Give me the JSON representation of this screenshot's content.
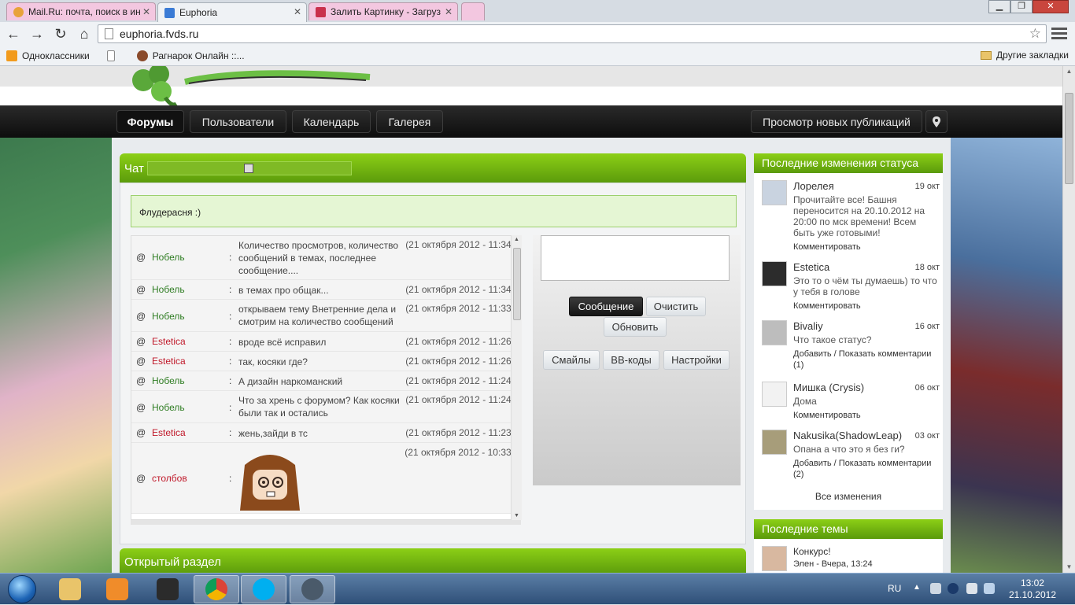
{
  "browser": {
    "tabs": [
      {
        "title": "Mail.Ru: почта, поиск в ин",
        "active": false,
        "color": "#e8a23a"
      },
      {
        "title": "Euphoria",
        "active": true,
        "color": "#3a7bd5"
      },
      {
        "title": "Залить Картинку - Загруз",
        "active": false,
        "color": "#c9304c"
      }
    ],
    "url": "euphoria.fvds.ru",
    "bookmarks": [
      {
        "label": "Одноклассники",
        "color": "#f29b1d"
      },
      {
        "label": "",
        "color": "#ffffff"
      },
      {
        "label": "Рагнарок Онлайн ::...",
        "color": "#8a4b2c"
      }
    ],
    "other_bookmarks": "Другие закладки"
  },
  "site": {
    "nav_left": [
      "Форумы",
      "Пользователи",
      "Календарь",
      "Галерея"
    ],
    "nav_right": "Просмотр новых публикаций"
  },
  "chat": {
    "title": "Чат",
    "topic": "Флудерасня :)",
    "messages": [
      {
        "nick": "Нобель",
        "nick_color": "green",
        "text": "Количество просмотров, количество сообщений в темах, последнее сообщение....",
        "time": "(21 октября 2012 - 11:34 )"
      },
      {
        "nick": "Нобель",
        "nick_color": "green",
        "text": "в темах про общак...",
        "time": "(21 октября 2012 - 11:34 )"
      },
      {
        "nick": "Нобель",
        "nick_color": "green",
        "text": "открываем тему Внетренние дела и смотрим на количество сообщений в темах",
        "time": "(21 октября 2012 - 11:33 )"
      },
      {
        "nick": "Estetica",
        "nick_color": "red",
        "text": "вроде всё исправил",
        "time": "(21 октября 2012 - 11:26 )"
      },
      {
        "nick": "Estetica",
        "nick_color": "red",
        "text": "так, косяки где?",
        "time": "(21 октября 2012 - 11:26 )"
      },
      {
        "nick": "Нобель",
        "nick_color": "green",
        "text": "А дизайн наркоманский",
        "time": "(21 октября 2012 - 11:24 )"
      },
      {
        "nick": "Нобель",
        "nick_color": "green",
        "text": "Что за хрень с форумом? Как косяки были так и остались",
        "time": "(21 октября 2012 - 11:24 )"
      },
      {
        "nick": "Estetica",
        "nick_color": "red",
        "text": "жень,зайди в тс",
        "time": "(21 октября 2012 - 11:23 )"
      },
      {
        "nick": "столбов",
        "nick_color": "red",
        "text": "",
        "time": "(21 октября 2012 - 10:33 )"
      }
    ],
    "buttons": {
      "send": "Сообщение",
      "clear": "Очистить",
      "refresh": "Обновить",
      "smileys": "Смайлы",
      "bbcodes": "BB-коды",
      "settings": "Настройки"
    }
  },
  "open_section": {
    "title": "Открытый раздел"
  },
  "status_updates": {
    "title": "Последние изменения статуса",
    "items": [
      {
        "name": "Лорелея",
        "date": "19 окт",
        "text": "Прочитайте все! Башня переносится на 20.10.2012 на 20:00 по мск времени! Всем быть уже готовыми!",
        "action": "Комментировать"
      },
      {
        "name": "Estetica",
        "date": "18 окт",
        "text": "Это то о чём ты думаешь) то что у тебя в голове",
        "action": "Комментировать"
      },
      {
        "name": "Bivaliy",
        "date": "16 окт",
        "text": "Что такое статус?",
        "action": "Добавить / Показать комментарии (1)"
      },
      {
        "name": "Мишка (Crysis)",
        "date": "06 окт",
        "text": "Дома",
        "action": "Комментировать"
      },
      {
        "name": "Nakusika(ShadowLeap)",
        "date": "03 окт",
        "text": "Опана а что это я без ги?",
        "action": "Добавить / Показать комментарии (2)"
      }
    ],
    "all_changes": "Все изменения"
  },
  "recent_topics": {
    "title": "Последние темы",
    "items": [
      {
        "title": "Конкурс!",
        "author": "Элен",
        "meta": " - Вчера, 13:24"
      }
    ]
  },
  "taskbar": {
    "lang": "RU",
    "time": "13:02",
    "date": "21.10.2012"
  }
}
